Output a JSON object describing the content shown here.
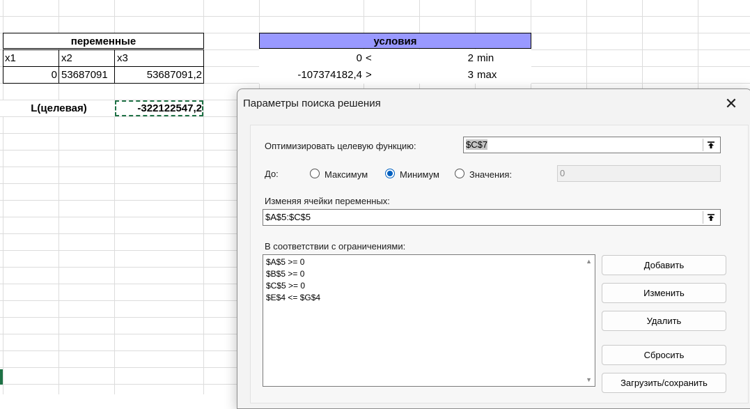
{
  "sheet": {
    "variables_header": "переменные",
    "conditions_header": "условия",
    "conditions_header_color": "#9999ff",
    "var_labels": [
      "x1",
      "x2",
      "x3"
    ],
    "var_values": [
      "0",
      "53687091",
      "53687091,2"
    ],
    "condition_rows": [
      {
        "value": "0",
        "sign": "<",
        "bound": "2",
        "label": "min"
      },
      {
        "value": "-107374182,4",
        "sign": ">",
        "bound": "3",
        "label": "max"
      }
    ],
    "objective_label": "L(целевая)",
    "objective_value": "-322122547,2"
  },
  "dialog": {
    "title": "Параметры поиска решения",
    "close_icon": "✕",
    "objective_label": "Оптимизировать целевую функцию:",
    "objective_cell": "$C$7",
    "to_label": "До:",
    "radio_max": "Максимум",
    "radio_min": "Минимум",
    "radio_value": "Значения:",
    "selected_radio": "min",
    "value_field": "0",
    "changing_label": "Изменяя ячейки переменных:",
    "changing_cells": "$A$5:$C$5",
    "constraints_label": "В соответствии с ограничениями:",
    "constraints": [
      "$A$5 >= 0",
      "$B$5 >= 0",
      "$C$5 >= 0",
      "$E$4 <= $G$4"
    ],
    "buttons": {
      "add": "Добавить",
      "change": "Изменить",
      "delete": "Удалить",
      "reset": "Сбросить",
      "load_save": "Загрузить/сохранить"
    },
    "accent_color": "#0060c0"
  }
}
